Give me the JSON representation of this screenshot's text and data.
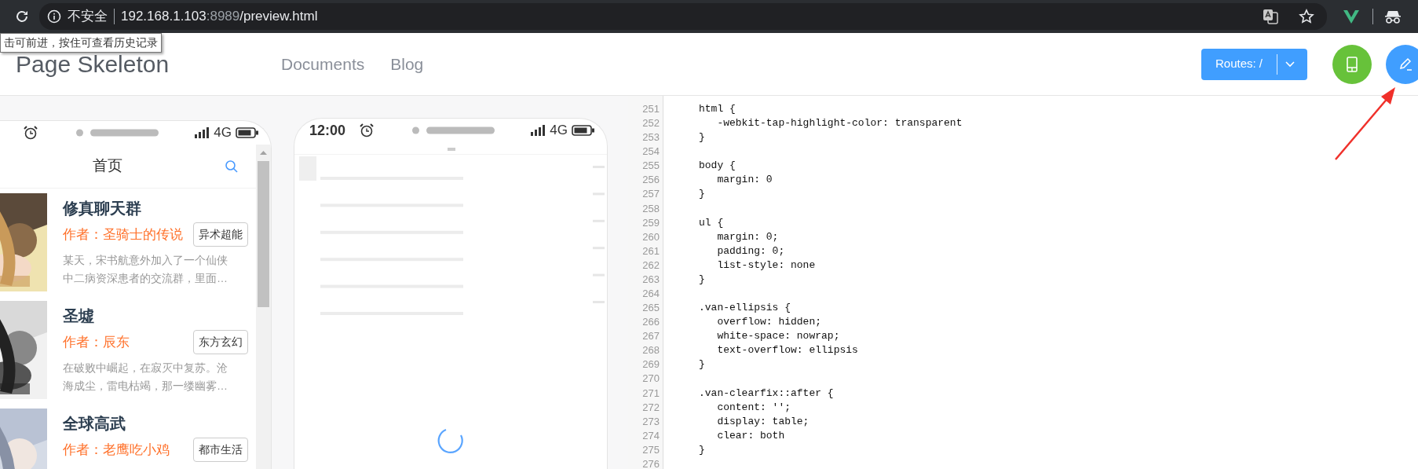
{
  "browser": {
    "security_label": "不安全",
    "url": {
      "host": "192.168.1.103",
      "port": ":8989",
      "path": "/preview.html"
    },
    "tooltip": "击可前进，按住可查看历史记录"
  },
  "header": {
    "logo": "Page Skeleton",
    "nav": [
      {
        "label": "Documents"
      },
      {
        "label": "Blog"
      }
    ],
    "routes_button": "Routes: /"
  },
  "live_phone": {
    "network": "4G",
    "nav_title": "首页",
    "books": [
      {
        "title": "修真聊天群",
        "author": "作者：圣骑士的传说",
        "tag": "异术超能",
        "description": "某天，宋书航意外加入了一个仙侠中二病资深患者的交流群，里面…"
      },
      {
        "title": "圣墟",
        "author": "作者：辰东",
        "tag": "东方玄幻",
        "description": "在破败中崛起，在寂灭中复苏。沧海成尘，雷电枯竭，那一缕幽雾…"
      },
      {
        "title": "全球高武",
        "author": "作者：老鹰吃小鸡",
        "tag": "都市生活"
      }
    ]
  },
  "skeleton_phone": {
    "time": "12:00",
    "network": "4G",
    "loading": true
  },
  "code_editor": {
    "lines": [
      {
        "number": "251",
        "text": "html {"
      },
      {
        "number": "252",
        "text": "   -webkit-tap-highlight-color: transparent"
      },
      {
        "number": "253",
        "text": "}"
      },
      {
        "number": "254"
      },
      {
        "number": "255",
        "text": "body {"
      },
      {
        "number": "256",
        "text": "   margin: 0"
      },
      {
        "number": "257",
        "text": "}"
      },
      {
        "number": "258"
      },
      {
        "number": "259",
        "text": "ul {"
      },
      {
        "number": "260",
        "text": "   margin: 0;"
      },
      {
        "number": "261",
        "text": "   padding: 0;"
      },
      {
        "number": "262",
        "text": "   list-style: none"
      },
      {
        "number": "263",
        "text": "}"
      },
      {
        "number": "264"
      },
      {
        "number": "265",
        "text": ".van-ellipsis {"
      },
      {
        "number": "266",
        "text": "   overflow: hidden;"
      },
      {
        "number": "267",
        "text": "   white-space: nowrap;"
      },
      {
        "number": "268",
        "text": "   text-overflow: ellipsis"
      },
      {
        "number": "269",
        "text": "}"
      },
      {
        "number": "270"
      },
      {
        "number": "271",
        "text": ".van-clearfix::after {"
      },
      {
        "number": "272",
        "text": "   content: '';"
      },
      {
        "number": "273",
        "text": "   display: table;"
      },
      {
        "number": "274",
        "text": "   clear: both"
      },
      {
        "number": "275",
        "text": "}"
      },
      {
        "number": "276"
      }
    ]
  }
}
